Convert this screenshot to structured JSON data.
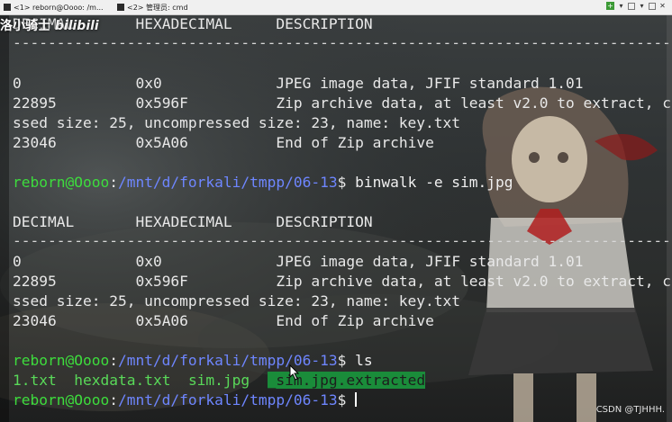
{
  "tabs": [
    {
      "label": "<1> reborn@Oooo: /m..."
    },
    {
      "label": "<2> 管理员: cmd"
    }
  ],
  "watermark": {
    "prefix": "洛小骑士",
    "brand": "bilibili"
  },
  "credit": "CSDN @TJHHH.",
  "terminal": {
    "header1": {
      "decimal": "DECIMAL",
      "hex": "HEXADECIMAL",
      "desc": "DESCRIPTION"
    },
    "sep1": "--------------------------------------------------------------------------------",
    "rows1": [
      {
        "decimal": "0",
        "hex": "0x0",
        "desc": "JPEG image data, JFIF standard 1.01"
      },
      {
        "decimal": "22895",
        "hex": "0x596F",
        "desc": "Zip archive data, at least v2.0 to extract, c"
      },
      {
        "cont": "ssed size: 25, uncompressed size: 23, name: key.txt"
      },
      {
        "decimal": "23046",
        "hex": "0x5A06",
        "desc": "End of Zip archive"
      }
    ],
    "prompt1": {
      "user": "reborn@Oooo",
      "sep": ":",
      "path": "/mnt/d/forkali/tmpp/06-13",
      "sym": "$ ",
      "cmd": "binwalk -e sim.jpg"
    },
    "header2": {
      "decimal": "DECIMAL",
      "hex": "HEXADECIMAL",
      "desc": "DESCRIPTION"
    },
    "sep2": "--------------------------------------------------------------------------------",
    "rows2": [
      {
        "decimal": "0",
        "hex": "0x0",
        "desc": "JPEG image data, JFIF standard 1.01"
      },
      {
        "decimal": "22895",
        "hex": "0x596F",
        "desc": "Zip archive data, at least v2.0 to extract, c"
      },
      {
        "cont": "ssed size: 25, uncompressed size: 23, name: key.txt"
      },
      {
        "decimal": "23046",
        "hex": "0x5A06",
        "desc": "End of Zip archive"
      }
    ],
    "prompt2": {
      "user": "reborn@Oooo",
      "sep": ":",
      "path": "/mnt/d/forkali/tmpp/06-13",
      "sym": "$ ",
      "cmd": "ls"
    },
    "ls": {
      "f1": "1.txt",
      "f2": "hexdata.txt",
      "f3": "sim.jpg",
      "dir": "_sim.jpg.extracted"
    },
    "prompt3": {
      "user": "reborn@Oooo",
      "sep": ":",
      "path": "/mnt/d/forkali/tmpp/06-13",
      "sym": "$ "
    }
  },
  "colors": {
    "user": "#3ddc3d",
    "path": "#6e86ff",
    "highlight": "#1a8c3a"
  }
}
